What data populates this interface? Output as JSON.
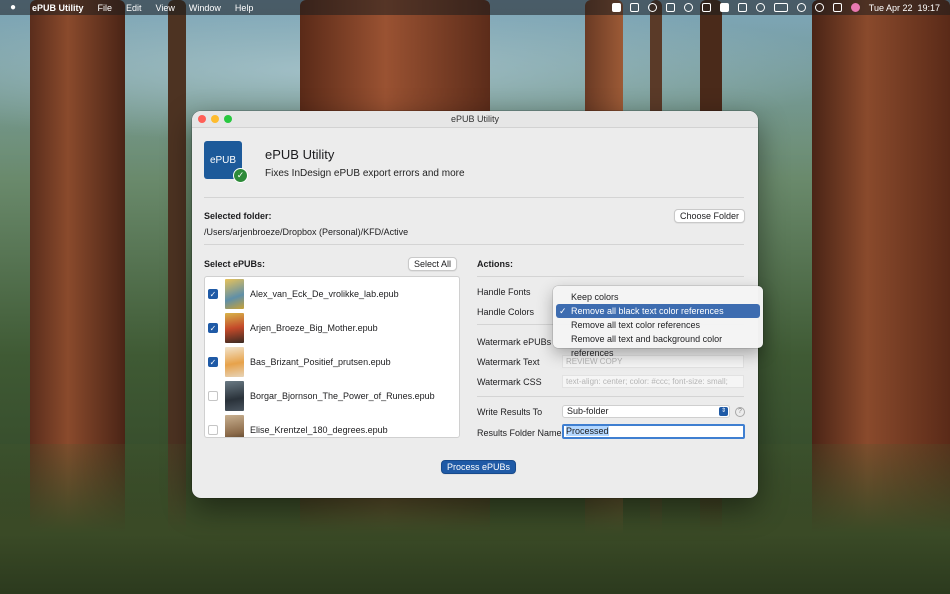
{
  "menubar": {
    "app_name": "ePUB Utility",
    "menus": [
      "File",
      "Edit",
      "View",
      "Window",
      "Help"
    ],
    "clock": "Tue Apr 22  19:17"
  },
  "window": {
    "title": "ePUB Utility",
    "app_icon_text": "ePUB",
    "app_name": "ePUB Utility",
    "subtitle": "Fixes InDesign ePUB export errors and more"
  },
  "folder": {
    "label": "Selected folder:",
    "path": "/Users/arjenbroeze/Dropbox (Personal)/KFD/Active",
    "choose_button": "Choose Folder"
  },
  "epubs": {
    "label": "Select ePUBs:",
    "select_all_button": "Select All",
    "files": [
      {
        "name": "Alex_van_Eck_De_vrolikke_lab.epub",
        "checked": true,
        "cover_color": "#c9a236"
      },
      {
        "name": "Arjen_Broeze_Big_Mother.epub",
        "checked": true,
        "cover_color": "#d8b44a"
      },
      {
        "name": "Bas_Brizant_Positief_prutsen.epub",
        "checked": true,
        "cover_color": "#e7d4b8"
      },
      {
        "name": "Borgar_Bjornson_The_Power_of_Runes.epub",
        "checked": false,
        "cover_color": "#4a5560"
      },
      {
        "name": "Elise_Krentzel_180_degrees.epub",
        "checked": false,
        "cover_color": "#8c6b4a"
      }
    ]
  },
  "actions": {
    "label": "Actions:",
    "handle_fonts": "Handle Fonts",
    "handle_colors": "Handle Colors",
    "watermark_epubs": "Watermark ePUBs",
    "watermark_text_label": "Watermark Text",
    "watermark_text_placeholder": "REVIEW COPY",
    "watermark_css_label": "Watermark CSS",
    "watermark_css_placeholder": "text-align: center; color: #ccc; font-size: small;",
    "write_results_label": "Write Results To",
    "write_results_value": "Sub-folder",
    "results_folder_label": "Results Folder Name",
    "results_folder_value": "Processed",
    "help_mark": "?"
  },
  "colors_menu": {
    "items": [
      "Keep colors",
      "Remove all black text color references",
      "Remove all text color references",
      "Remove all text and background color references"
    ],
    "selected_index": 1,
    "check_mark": "✓"
  },
  "process_button": "Process ePUBs"
}
